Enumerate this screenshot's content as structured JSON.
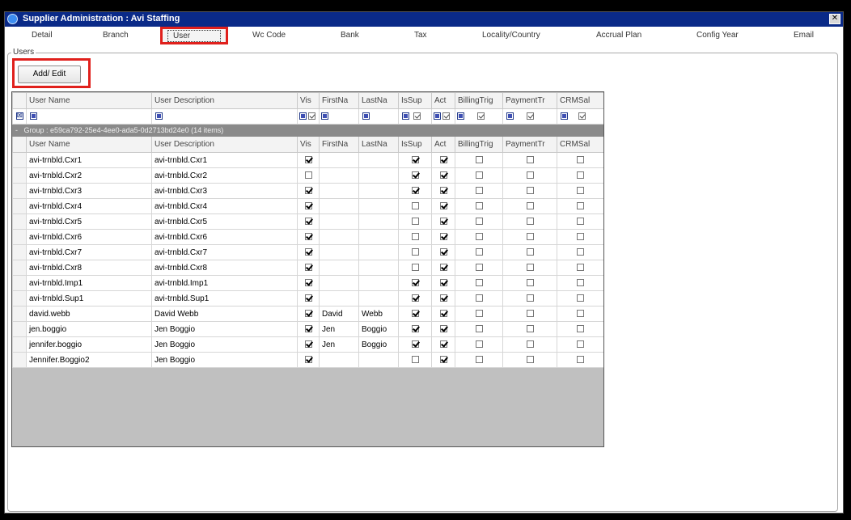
{
  "window": {
    "title": "Supplier Administration : Avi Staffing",
    "close_glyph": "✕"
  },
  "tabs": [
    {
      "label": "Detail"
    },
    {
      "label": "Branch"
    },
    {
      "label": "User"
    },
    {
      "label": "Wc Code"
    },
    {
      "label": "Bank"
    },
    {
      "label": "Tax"
    },
    {
      "label": "Locality/Country"
    },
    {
      "label": "Accrual Plan"
    },
    {
      "label": "Config Year"
    },
    {
      "label": "Email"
    }
  ],
  "users_group": {
    "label": "Users",
    "add_edit_label": "Add/ Edit"
  },
  "grid": {
    "columns": [
      "User Name",
      "User Description",
      "Vis",
      "FirstNa",
      "LastNa",
      "IsSup",
      "Act",
      "BillingTrig",
      "PaymentTr",
      "CRMSal"
    ],
    "group_label": "Group : e59ca792-25e4-4ee0-ada5-0d2713bd24e0 (14 items)",
    "group_toggle": "-",
    "rows": [
      {
        "user_name": "avi-trnbld.Cxr1",
        "description": "avi-trnbld.Cxr1",
        "vis": true,
        "first": "",
        "last": "",
        "is_sup": true,
        "act": true,
        "billing": false,
        "payment": false,
        "crm": false
      },
      {
        "user_name": "avi-trnbld.Cxr2",
        "description": "avi-trnbld.Cxr2",
        "vis": false,
        "first": "",
        "last": "",
        "is_sup": true,
        "act": true,
        "billing": false,
        "payment": false,
        "crm": false
      },
      {
        "user_name": "avi-trnbld.Cxr3",
        "description": "avi-trnbld.Cxr3",
        "vis": true,
        "first": "",
        "last": "",
        "is_sup": true,
        "act": true,
        "billing": false,
        "payment": false,
        "crm": false
      },
      {
        "user_name": "avi-trnbld.Cxr4",
        "description": "avi-trnbld.Cxr4",
        "vis": true,
        "first": "",
        "last": "",
        "is_sup": false,
        "act": true,
        "billing": false,
        "payment": false,
        "crm": false
      },
      {
        "user_name": "avi-trnbld.Cxr5",
        "description": "avi-trnbld.Cxr5",
        "vis": true,
        "first": "",
        "last": "",
        "is_sup": false,
        "act": true,
        "billing": false,
        "payment": false,
        "crm": false
      },
      {
        "user_name": "avi-trnbld.Cxr6",
        "description": "avi-trnbld.Cxr6",
        "vis": true,
        "first": "",
        "last": "",
        "is_sup": false,
        "act": true,
        "billing": false,
        "payment": false,
        "crm": false
      },
      {
        "user_name": "avi-trnbld.Cxr7",
        "description": "avi-trnbld.Cxr7",
        "vis": true,
        "first": "",
        "last": "",
        "is_sup": false,
        "act": true,
        "billing": false,
        "payment": false,
        "crm": false
      },
      {
        "user_name": "avi-trnbld.Cxr8",
        "description": "avi-trnbld.Cxr8",
        "vis": true,
        "first": "",
        "last": "",
        "is_sup": false,
        "act": true,
        "billing": false,
        "payment": false,
        "crm": false
      },
      {
        "user_name": "avi-trnbld.Imp1",
        "description": "avi-trnbld.Imp1",
        "vis": true,
        "first": "",
        "last": "",
        "is_sup": true,
        "act": true,
        "billing": false,
        "payment": false,
        "crm": false
      },
      {
        "user_name": "avi-trnbld.Sup1",
        "description": "avi-trnbld.Sup1",
        "vis": true,
        "first": "",
        "last": "",
        "is_sup": true,
        "act": true,
        "billing": false,
        "payment": false,
        "crm": false
      },
      {
        "user_name": "david.webb",
        "description": "David Webb",
        "vis": true,
        "first": "David",
        "last": "Webb",
        "is_sup": true,
        "act": true,
        "billing": false,
        "payment": false,
        "crm": false
      },
      {
        "user_name": "jen.boggio",
        "description": "Jen Boggio",
        "vis": true,
        "first": "Jen",
        "last": "Boggio",
        "is_sup": true,
        "act": true,
        "billing": false,
        "payment": false,
        "crm": false
      },
      {
        "user_name": "jennifer.boggio",
        "description": "Jen Boggio",
        "vis": true,
        "first": "Jen",
        "last": "Boggio",
        "is_sup": true,
        "act": true,
        "billing": false,
        "payment": false,
        "crm": false
      },
      {
        "user_name": "Jennifer.Boggio2",
        "description": "Jen Boggio",
        "vis": true,
        "first": "",
        "last": "",
        "is_sup": false,
        "act": true,
        "billing": false,
        "payment": false,
        "crm": false
      }
    ]
  },
  "colors": {
    "title_bar": "#0a2a88",
    "highlight": "#e0201c",
    "group_row": "#8a8a8a",
    "grid_bg": "#c0c0c0"
  }
}
